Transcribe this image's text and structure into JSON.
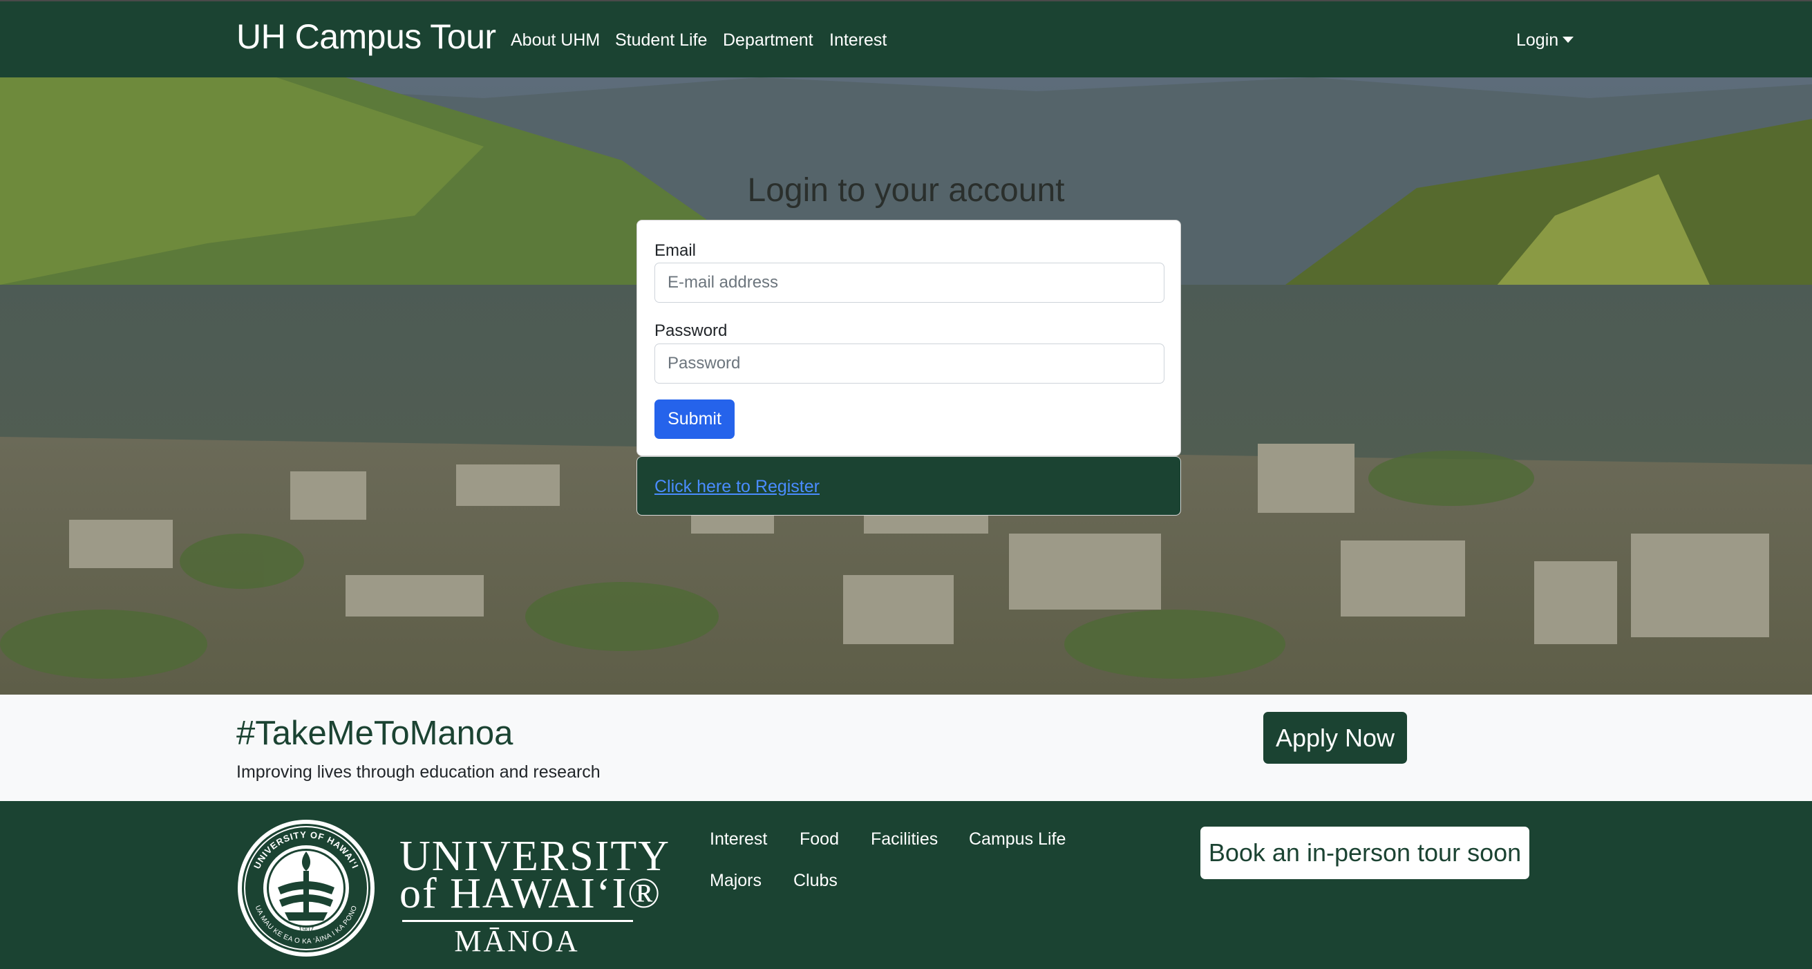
{
  "navbar": {
    "brand": "UH Campus Tour",
    "links": [
      "About UHM",
      "Student Life",
      "Department",
      "Interest"
    ],
    "login_label": "Login"
  },
  "hero": {
    "title": "Login to your account"
  },
  "login_form": {
    "email_label": "Email",
    "email_placeholder": "E-mail address",
    "email_value": "",
    "password_label": "Password",
    "password_placeholder": "Password",
    "password_value": "",
    "submit_label": "Submit"
  },
  "register": {
    "link_text": "Click here to Register"
  },
  "banner": {
    "hashtag": "#TakeMeToManoa",
    "tagline": "Improving lives through education and research",
    "apply_label": "Apply Now"
  },
  "footer": {
    "logo": {
      "line1": "UNIVERSITY",
      "line2": "of HAWAI‘I®",
      "line3": "MĀNOA",
      "seal_text_top": "UNIVERSITY OF HAWAI‘I",
      "seal_text_bottom": "UA MAU KE EA O KA ‘ĀINA I KA PONO",
      "seal_year": "1907"
    },
    "links": [
      "Interest",
      "Food",
      "Facilities",
      "Campus Life",
      "Majors",
      "Clubs"
    ],
    "tour_label": "Book an in-person tour soon"
  },
  "colors": {
    "primary_green": "#1b4332",
    "submit_blue": "#2563eb",
    "banner_bg": "#f8f9fa"
  },
  "icons": {
    "login_caret": "caret-down-icon",
    "seal": "university-seal-icon"
  }
}
